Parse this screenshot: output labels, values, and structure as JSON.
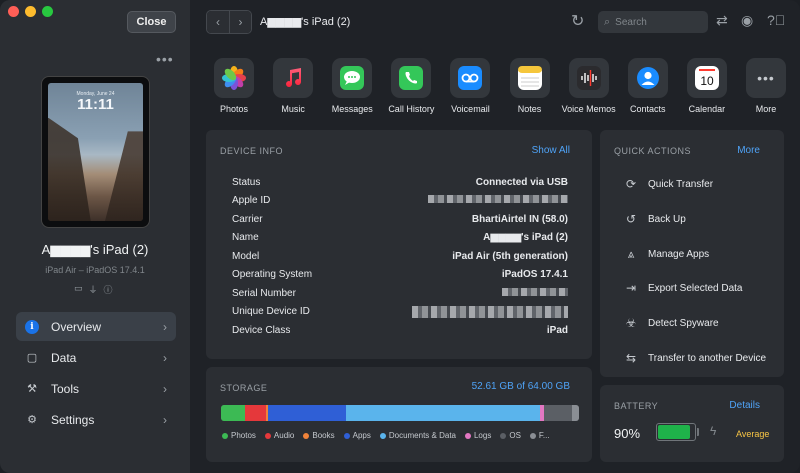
{
  "window": {
    "close_label": "Close"
  },
  "device": {
    "name": "A▆▆▆▆'s iPad (2)",
    "subtitle": "iPad Air – iPadOS 17.4.1",
    "lock_time": "11:11",
    "lock_date": "Monday, June 24"
  },
  "sidebar": {
    "items": [
      {
        "label": "Overview",
        "icon": "info-icon",
        "active": true
      },
      {
        "label": "Data",
        "icon": "square-icon"
      },
      {
        "label": "Tools",
        "icon": "tools-icon"
      },
      {
        "label": "Settings",
        "icon": "gear-icon"
      }
    ]
  },
  "topbar": {
    "title": "A▆▆▆▆'s iPad (2)",
    "search_placeholder": "Search"
  },
  "apps": [
    {
      "label": "Photos",
      "icon": "photos-icon"
    },
    {
      "label": "Music",
      "icon": "music-icon"
    },
    {
      "label": "Messages",
      "icon": "messages-icon"
    },
    {
      "label": "Call History",
      "icon": "phone-icon"
    },
    {
      "label": "Voicemail",
      "icon": "voicemail-icon"
    },
    {
      "label": "Notes",
      "icon": "notes-icon"
    },
    {
      "label": "Voice Memos",
      "icon": "voice-memos-icon"
    },
    {
      "label": "Contacts",
      "icon": "contacts-icon"
    },
    {
      "label": "Calendar",
      "icon": "calendar-icon",
      "day": "10"
    },
    {
      "label": "More",
      "icon": "more-icon"
    }
  ],
  "device_info": {
    "heading": "DEVICE INFO",
    "show_all": "Show All",
    "rows": [
      {
        "key": "Status",
        "value": "Connected via USB"
      },
      {
        "key": "Apple ID",
        "value": "",
        "masked": true
      },
      {
        "key": "Carrier",
        "value": "BhartiAirtel IN (58.0)"
      },
      {
        "key": "Name",
        "value": "A▆▆▆▆'s iPad (2)"
      },
      {
        "key": "Model",
        "value": "iPad Air (5th generation)"
      },
      {
        "key": "Operating System",
        "value": "iPadOS 17.4.1"
      },
      {
        "key": "Serial Number",
        "value": "",
        "masked": true
      },
      {
        "key": "Unique Device ID",
        "value": "",
        "masked": true
      },
      {
        "key": "Device Class",
        "value": "iPad"
      }
    ]
  },
  "quick_actions": {
    "heading": "QUICK ACTIONS",
    "more": "More",
    "items": [
      {
        "label": "Quick Transfer",
        "icon": "transfer-icon"
      },
      {
        "label": "Back Up",
        "icon": "backup-icon"
      },
      {
        "label": "Manage Apps",
        "icon": "apps-icon"
      },
      {
        "label": "Export Selected Data",
        "icon": "export-icon"
      },
      {
        "label": "Detect Spyware",
        "icon": "biohazard-icon"
      },
      {
        "label": "Transfer to another Device",
        "icon": "device-transfer-icon"
      }
    ]
  },
  "storage": {
    "heading": "STORAGE",
    "summary": "52.61 GB of 64.00 GB",
    "used_gb": 52.61,
    "total_gb": 64.0,
    "segments": [
      {
        "label": "Photos",
        "color": "#3cba54",
        "fraction": 0.066
      },
      {
        "label": "Audio",
        "color": "#e5383b",
        "fraction": 0.06
      },
      {
        "label": "Books",
        "color": "#f0833a",
        "fraction": 0.004
      },
      {
        "label": "Apps",
        "color": "#2f5fd6",
        "fraction": 0.22
      },
      {
        "label": "Documents & Data",
        "color": "#5ab4ec",
        "fraction": 0.54
      },
      {
        "label": "Logs",
        "color": "#e377c2",
        "fraction": 0.012
      },
      {
        "label": "OS",
        "color": "#5b5f65",
        "fraction": 0.08
      },
      {
        "label": "F...",
        "color": "#8a8e94",
        "fraction": 0.018
      }
    ]
  },
  "battery": {
    "heading": "BATTERY",
    "details": "Details",
    "percent_label": "90%",
    "level": 0.9,
    "health": "Average"
  }
}
